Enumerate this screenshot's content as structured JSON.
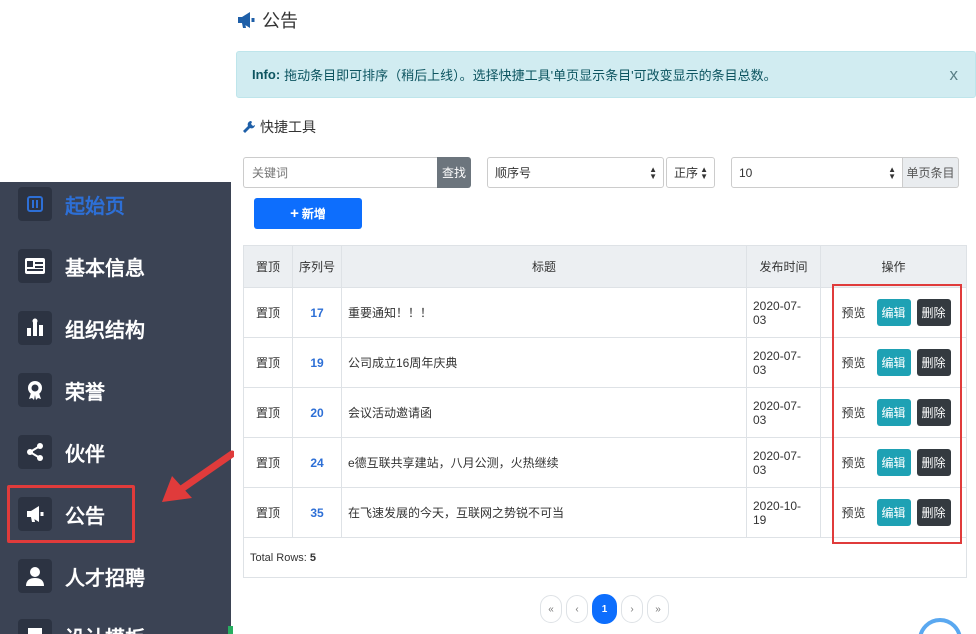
{
  "page": {
    "title": "公告",
    "title_icon": "megaphone-icon"
  },
  "info": {
    "label": "Info:",
    "text": "拖动条目即可排序（稍后上线）。选择快捷工具'单页显示条目'可改变显示的条目总数。",
    "close": "x"
  },
  "tools": {
    "title": "快捷工具",
    "icon": "wrench-icon"
  },
  "search": {
    "placeholder": "关键词",
    "button": "查找"
  },
  "sort_field": {
    "value": "顺序号"
  },
  "sort_order": {
    "value": "正序"
  },
  "per_page": {
    "value": "10",
    "label": "单页条目"
  },
  "add_button": {
    "icon": "+",
    "label": "新增"
  },
  "sidebar": {
    "items": [
      {
        "label": "起始页",
        "icon": "home-icon"
      },
      {
        "label": "基本信息",
        "icon": "id-card-icon"
      },
      {
        "label": "组织结构",
        "icon": "org-chart-icon"
      },
      {
        "label": "荣誉",
        "icon": "award-icon"
      },
      {
        "label": "伙伴",
        "icon": "share-icon"
      },
      {
        "label": "公告",
        "icon": "megaphone-icon"
      },
      {
        "label": "人才招聘",
        "icon": "user-icon"
      },
      {
        "label": "设计模板",
        "icon": "template-icon"
      }
    ]
  },
  "table": {
    "headers": [
      "置顶",
      "序列号",
      "标题",
      "发布时间",
      "操作"
    ],
    "rows": [
      {
        "pin": "置顶",
        "seq": "17",
        "title": "重要通知！！！",
        "date": "2020-07-03"
      },
      {
        "pin": "置顶",
        "seq": "19",
        "title": "公司成立16周年庆典",
        "date": "2020-07-03"
      },
      {
        "pin": "置顶",
        "seq": "20",
        "title": "会议活动邀请函",
        "date": "2020-07-03"
      },
      {
        "pin": "置顶",
        "seq": "24",
        "title": "e德互联共享建站，八月公测，火热继续",
        "date": "2020-07-03"
      },
      {
        "pin": "置顶",
        "seq": "35",
        "title": "在飞速发展的今天，互联网之势锐不可当",
        "date": "2020-10-19"
      }
    ],
    "actions": {
      "preview": "预览",
      "edit": "编辑",
      "delete": "删除"
    },
    "footer_label": "Total Rows:",
    "footer_count": "5"
  },
  "pagination": {
    "first": "«",
    "prev": "‹",
    "current": "1",
    "next": "›",
    "last": "»"
  },
  "colors": {
    "sidebar_bg": "#3b4354",
    "primary": "#0d6efd",
    "edit": "#1ea1b4",
    "delete": "#343a40",
    "highlight": "#e03b3b",
    "info_bg": "#d1ecf1"
  }
}
